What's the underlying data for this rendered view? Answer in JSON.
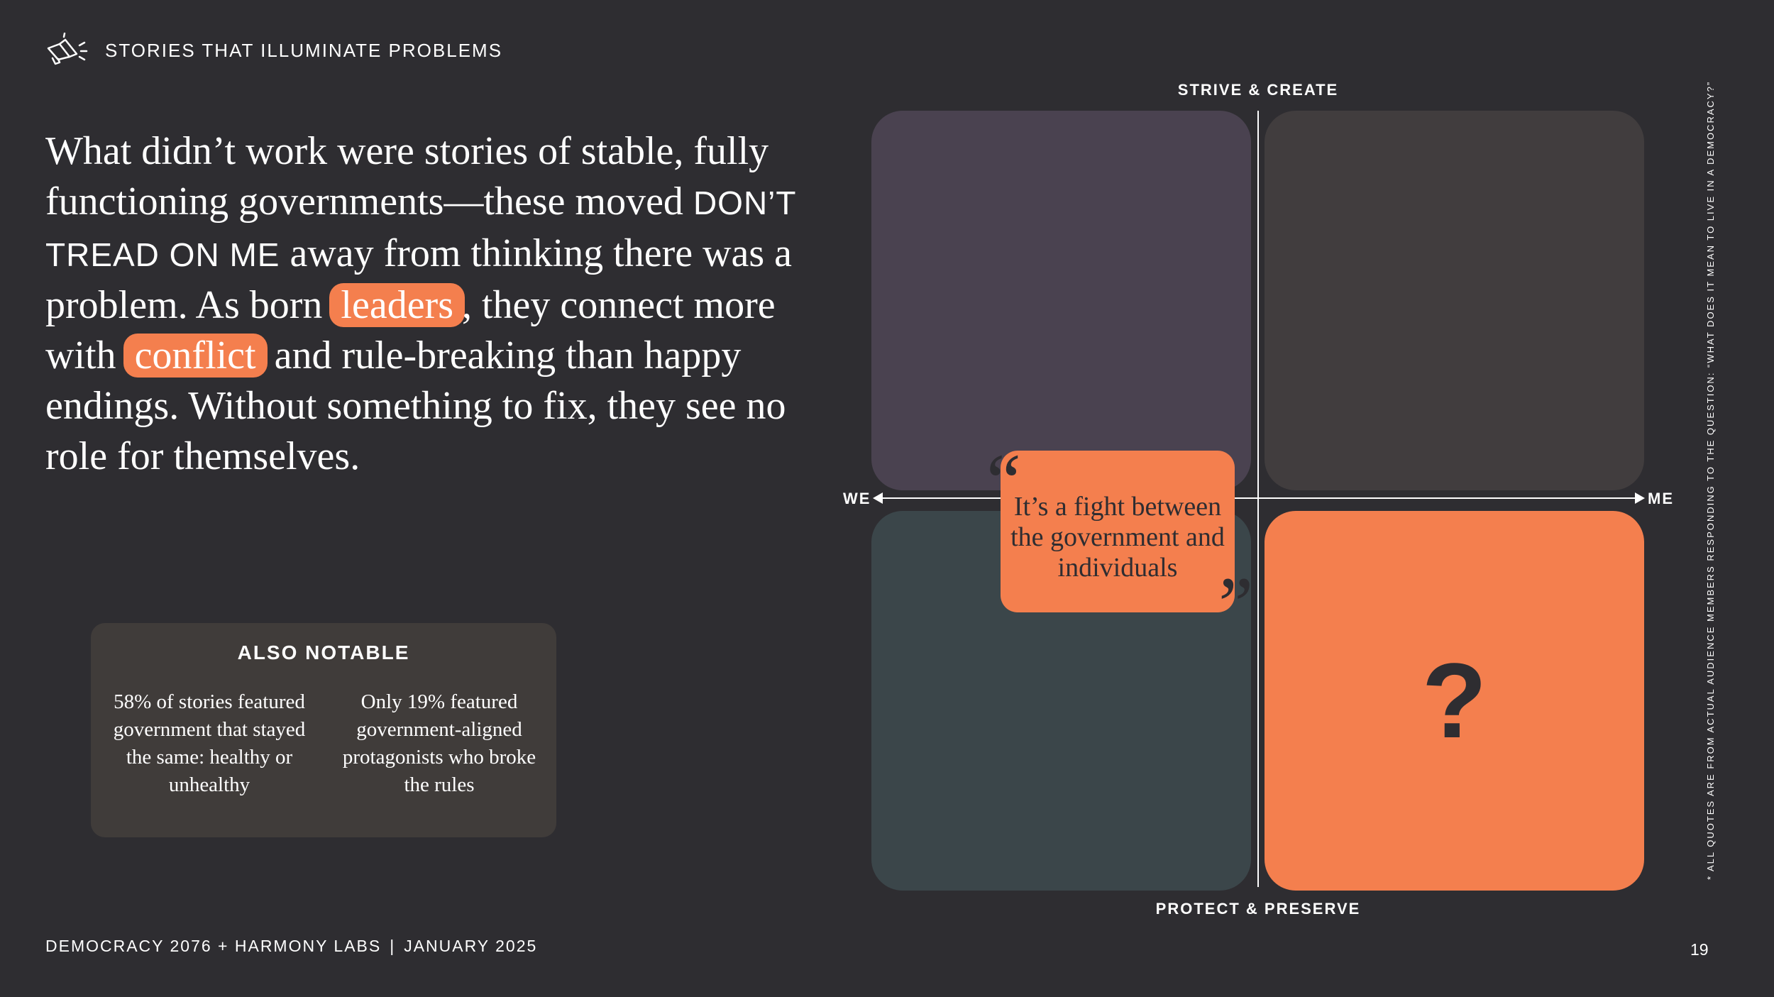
{
  "header": {
    "section_title": "STORIES THAT ILLUMINATE PROBLEMS",
    "icon": "megaphone-icon"
  },
  "body": {
    "part1": "What didn’t work were stories of stable, fully functioning governments—these moved ",
    "brand": "DON’T TREAD ON ME",
    "part2": " away from thinking there was a problem. As born ",
    "highlight1": "leaders",
    "part3": ", they connect more with ",
    "highlight2": "conflict",
    "part4": " and rule-breaking than happy endings. Without something to fix, they see no role for themselves."
  },
  "also_notable": {
    "title": "ALSO NOTABLE",
    "col1": "58% of stories featured government that stayed the same: healthy or unhealthy",
    "col2": "Only 19% featured government-aligned protagonists who broke the rules"
  },
  "quadrant": {
    "top_label": "STRIVE & CREATE",
    "bottom_label": "PROTECT & PRESERVE",
    "left_label": "WE",
    "right_label": "ME",
    "unknown_mark": "?",
    "quote": "It’s a fight between the government and individuals",
    "quote_open": "“",
    "quote_close": "”",
    "colors": {
      "top_left": "#4a4250",
      "top_right": "#413d3e",
      "bottom_left": "#3b464a",
      "bottom_right": "#f47f4e"
    }
  },
  "side_note": "* ALL QUOTES ARE FROM ACTUAL AUDIENCE MEMBERS RESPONDING TO THE QUESTION: “WHAT DOES IT MEAN TO LIVE IN A DEMOCRACY?”",
  "footer": {
    "org": "DEMOCRACY 2076 + HARMONY LABS",
    "separator": "|",
    "date": "JANUARY 2025",
    "page": "19"
  },
  "colors": {
    "background": "#2e2d31",
    "accent": "#f47f4e",
    "panel": "#403c3a"
  }
}
